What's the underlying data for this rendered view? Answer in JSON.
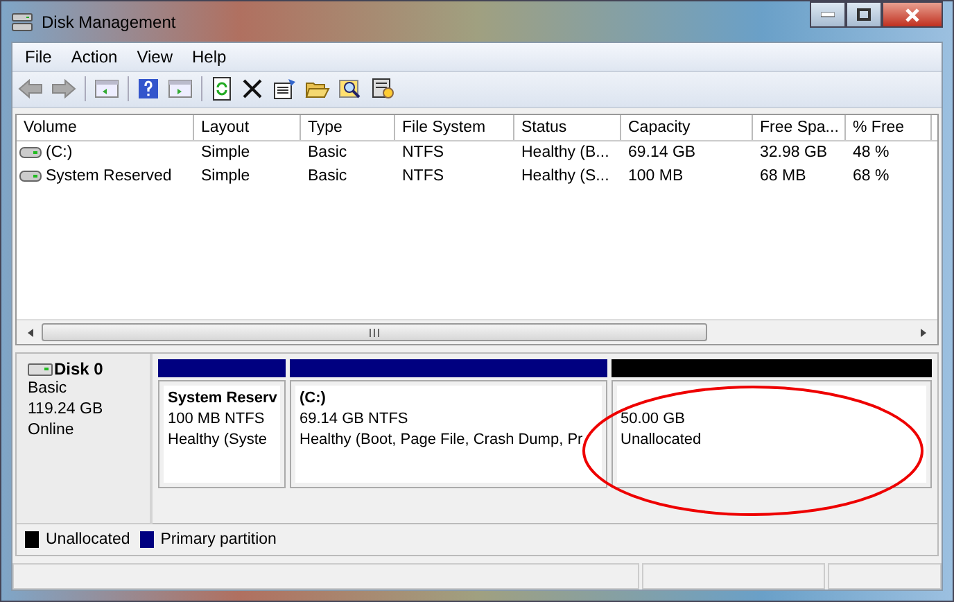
{
  "window": {
    "title": "Disk Management"
  },
  "menu": [
    "File",
    "Action",
    "View",
    "Help"
  ],
  "table": {
    "columns": [
      "Volume",
      "Layout",
      "Type",
      "File System",
      "Status",
      "Capacity",
      "Free Spa...",
      "% Free"
    ],
    "rows": [
      {
        "cells": [
          "(C:)",
          "Simple",
          "Basic",
          "NTFS",
          "Healthy (B...",
          "69.14 GB",
          "32.98 GB",
          "48 %"
        ]
      },
      {
        "cells": [
          "System Reserved",
          "Simple",
          "Basic",
          "NTFS",
          "Healthy (S...",
          "100 MB",
          "68 MB",
          "68 %"
        ]
      }
    ]
  },
  "disk": {
    "name": "Disk 0",
    "type": "Basic",
    "size": "119.24 GB",
    "state": "Online",
    "partitions": [
      {
        "kind": "primary",
        "name": "System Reserv",
        "size": "100 MB NTFS",
        "status": "Healthy (Syste"
      },
      {
        "kind": "primary",
        "name": "(C:)",
        "size": "69.14 GB NTFS",
        "status": "Healthy (Boot, Page File, Crash Dump, Pr"
      },
      {
        "kind": "unallocated",
        "size": "50.00 GB",
        "status": "Unallocated"
      }
    ]
  },
  "legend": [
    {
      "label": "Unallocated",
      "color": "#000000"
    },
    {
      "label": "Primary partition",
      "color": "#000080"
    }
  ]
}
